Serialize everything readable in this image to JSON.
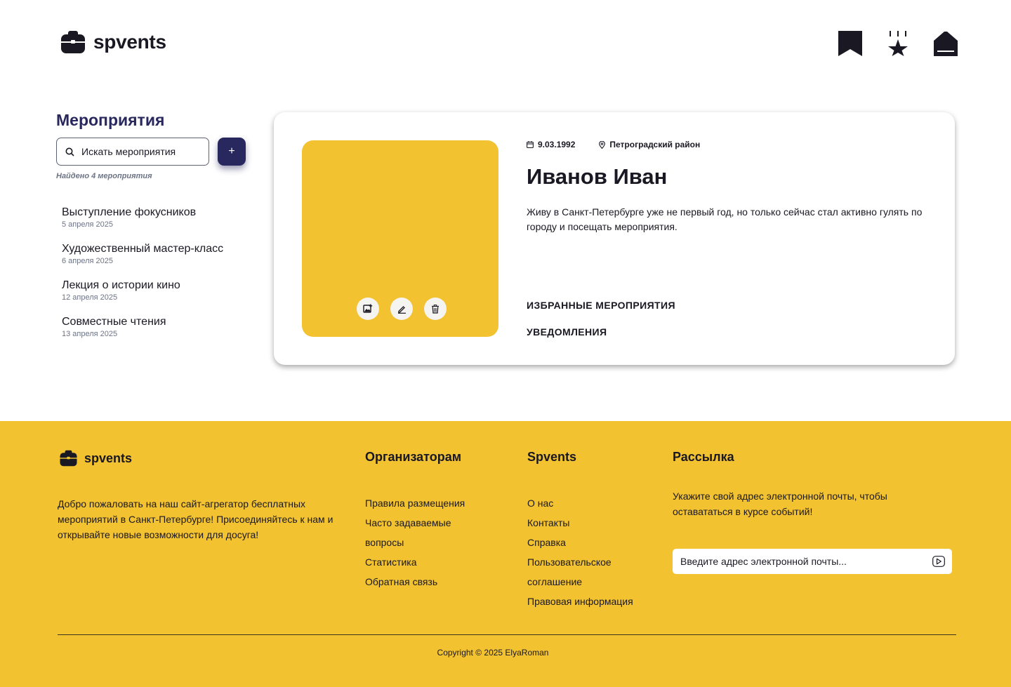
{
  "header": {
    "logo_text": "spvents",
    "nav_icons": [
      "bookmark-icon",
      "favorites-star-icon",
      "home-icon"
    ]
  },
  "sidebar": {
    "title": "Мероприятия",
    "search_placeholder": "Искать мероприятия",
    "add_label": "+",
    "found_text": "Найдено 4 мероприятия",
    "events": [
      {
        "title": "Выступление фокусников",
        "date": "5 апреля 2025"
      },
      {
        "title": "Художественный мастер-класс",
        "date": "6 апреля 2025"
      },
      {
        "title": "Лекция о истории кино",
        "date": "12 апреля 2025"
      },
      {
        "title": "Совместные чтения",
        "date": "13 апреля 2025"
      }
    ]
  },
  "profile": {
    "birth_date": "9.03.1992",
    "district": "Петроградский район",
    "name": "Иванов Иван",
    "bio": "Живу в Санкт-Петербурге уже не первый год, но только сейчас стал активно гулять по городу и посещать мероприятия.",
    "favorites_link": "ИЗБРАННЫЕ МЕРОПРИЯТИЯ",
    "notifications_link": "УВЕДОМЛЕНИЯ",
    "photo_actions": [
      "change-photo-icon",
      "edit-icon",
      "delete-icon"
    ]
  },
  "footer": {
    "logo_text": "spvents",
    "description": "Добро пожаловать на наш сайт-агрегатор бесплатных мероприятий в Санкт-Петербурге! Присоединяйтесь к нам и открывайте новые возможности для досуга!",
    "organizers": {
      "title": "Организаторам",
      "links": [
        "Правила размещения",
        "Часто задаваемые вопросы",
        "Статистика",
        "Обратная связь"
      ]
    },
    "spvents": {
      "title": "Spvents",
      "links": [
        "О нас",
        "Контакты",
        "Справка",
        "Пользовательское соглашение",
        "Правовая информация"
      ]
    },
    "newsletter": {
      "title": "Рассылка",
      "text": "Укажите свой адрес электронной почты, чтобы оставататься в курсе событий!",
      "email_placeholder": "Введите адрес электронной почты..."
    },
    "copyright": "Copyright © 2025 ElyaRoman"
  },
  "colors": {
    "accent_yellow": "#f2c230",
    "brand_navy": "#28275e",
    "text_dark": "#1a1822"
  }
}
